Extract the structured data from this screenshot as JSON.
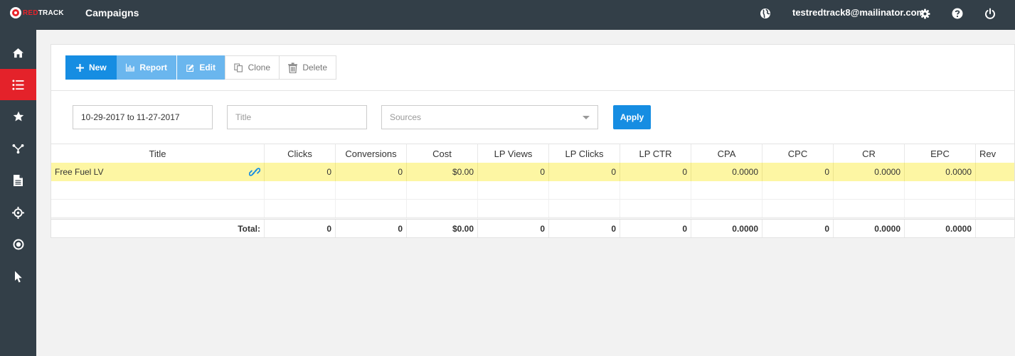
{
  "app": {
    "logo_red": "RED",
    "logo_white": "TRACK",
    "page_title": "Campaigns",
    "user_email": "testredtrack8@mailinator.com",
    "colors": {
      "topbar": "#333f48",
      "accent": "#168de2",
      "active_nav": "#e4222a",
      "highlight_row": "#fdf6a3"
    }
  },
  "header_icons": [
    "globe-icon",
    "gear-icon",
    "help-icon",
    "power-icon"
  ],
  "sidebar": {
    "items": [
      {
        "name": "home",
        "icon": "home-icon",
        "active": false
      },
      {
        "name": "campaigns",
        "icon": "list-icon",
        "active": true
      },
      {
        "name": "offers",
        "icon": "star-icon",
        "active": false
      },
      {
        "name": "funnels",
        "icon": "funnel-icon",
        "active": false
      },
      {
        "name": "landings",
        "icon": "document-icon",
        "active": false
      },
      {
        "name": "sources",
        "icon": "crosshair-icon",
        "active": false
      },
      {
        "name": "targets",
        "icon": "target-icon",
        "active": false
      },
      {
        "name": "clicks",
        "icon": "pointer-icon",
        "active": false
      }
    ]
  },
  "toolbar": {
    "new_label": "New",
    "report_label": "Report",
    "edit_label": "Edit",
    "clone_label": "Clone",
    "delete_label": "Delete"
  },
  "filters": {
    "date_range": "10-29-2017 to 11-27-2017",
    "title_placeholder": "Title",
    "sources_placeholder": "Sources",
    "apply_label": "Apply"
  },
  "table": {
    "columns": [
      "Title",
      "Clicks",
      "Conversions",
      "Cost",
      "LP Views",
      "LP Clicks",
      "LP CTR",
      "CPA",
      "CPC",
      "CR",
      "EPC",
      "Rev"
    ],
    "rows": [
      {
        "title": "Free Fuel LV",
        "clicks": "0",
        "conversions": "0",
        "cost": "$0.00",
        "lp_views": "0",
        "lp_clicks": "0",
        "lp_ctr": "0",
        "cpa": "0.0000",
        "cpc": "0",
        "cr": "0.0000",
        "epc": "0.0000"
      }
    ],
    "totals": {
      "label": "Total:",
      "clicks": "0",
      "conversions": "0",
      "cost": "$0.00",
      "lp_views": "0",
      "lp_clicks": "0",
      "lp_ctr": "0",
      "cpa": "0.0000",
      "cpc": "0",
      "cr": "0.0000",
      "epc": "0.0000"
    }
  }
}
